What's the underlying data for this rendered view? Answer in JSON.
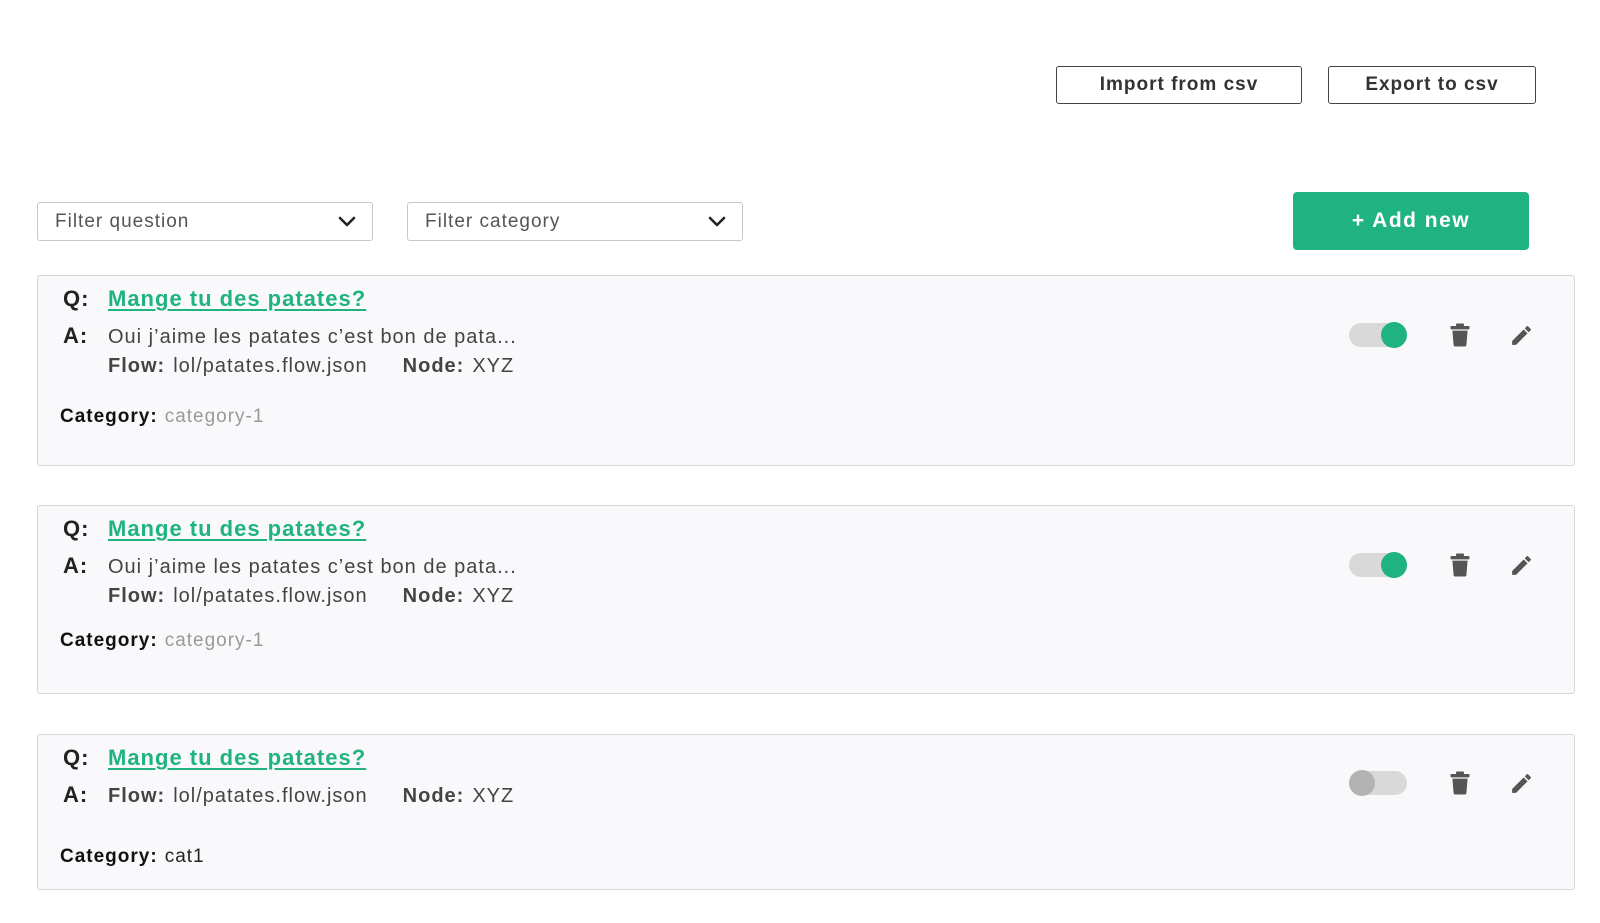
{
  "toolbar": {
    "import_label": "Import from csv",
    "export_label": "Export to csv"
  },
  "filters": {
    "question_placeholder": "Filter question",
    "category_placeholder": "Filter category"
  },
  "add_new_label": "+ Add new",
  "labels": {
    "q_prefix": "Q:",
    "a_prefix": "A:",
    "flow": "Flow:",
    "node": "Node:",
    "category": "Category:"
  },
  "items": [
    {
      "question": "Mange tu des patates?",
      "answer": "Oui j’aime les patates c’est bon de pata...",
      "flow": "lol/patates.flow.json",
      "node": "XYZ",
      "category": "category-1",
      "enabled": true
    },
    {
      "question": "Mange tu des patates?",
      "answer": "Oui j’aime les patates c’est bon de pata...",
      "flow": "lol/patates.flow.json",
      "node": "XYZ",
      "category": "category-1",
      "enabled": true
    },
    {
      "question": "Mange tu des patates?",
      "answer": "",
      "flow": "lol/patates.flow.json",
      "node": "XYZ",
      "category": "cat1",
      "enabled": false
    }
  ],
  "icons": {
    "trash": "trash-icon",
    "edit": "pencil-icon",
    "chevron": "chevron-down-icon"
  },
  "colors": {
    "accent": "#1fb382",
    "toggle_off_knob": "#b3b3b3",
    "toggle_track": "#d9d9d9",
    "icon": "#555555"
  }
}
